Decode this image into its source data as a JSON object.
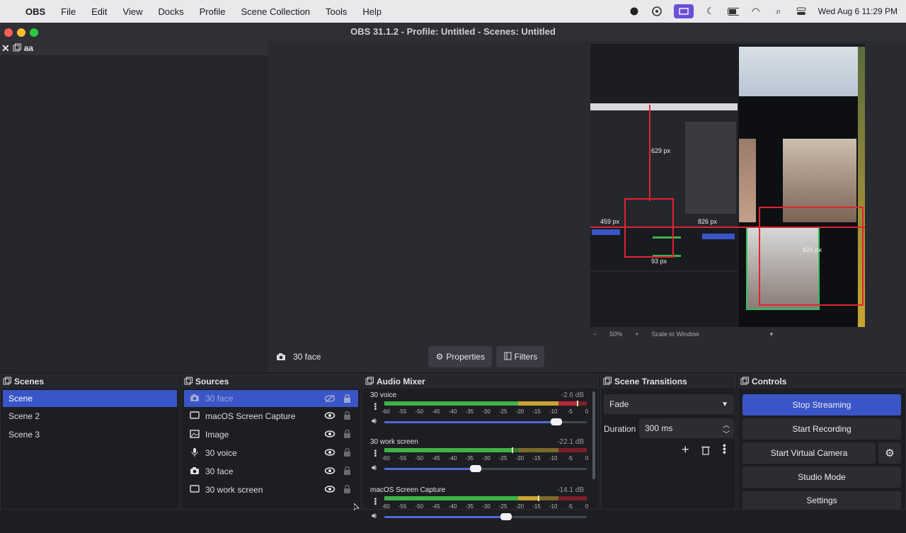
{
  "menubar": {
    "app": "OBS",
    "items": [
      "File",
      "Edit",
      "View",
      "Docks",
      "Profile",
      "Scene Collection",
      "Tools",
      "Help"
    ],
    "datetime": "Wed Aug 6  11:29 PM"
  },
  "window": {
    "title": "OBS 31.1.2 - Profile: Untitled - Scenes: Untitled"
  },
  "left_dock": {
    "title": "aa"
  },
  "preview": {
    "measure_labels": [
      "629 px",
      "459 px",
      "826 px",
      "826 px",
      "93 px"
    ],
    "zoom_minus": "−",
    "zoom_value": "50%",
    "zoom_plus": "+",
    "scale_mode": "Scale to Window"
  },
  "source_toolbar": {
    "current_source": "30 face",
    "properties_label": "Properties",
    "filters_label": "Filters"
  },
  "scenes": {
    "title": "Scenes",
    "items": [
      "Scene",
      "Scene 2",
      "Scene 3"
    ],
    "selected_index": 0
  },
  "sources": {
    "title": "Sources",
    "items": [
      {
        "name": "30 face",
        "icon": "camera-icon",
        "hidden": true
      },
      {
        "name": "macOS Screen Capture",
        "icon": "monitor-icon",
        "hidden": false
      },
      {
        "name": "Image",
        "icon": "image-icon",
        "hidden": false
      },
      {
        "name": "30 voice",
        "icon": "microphone-icon",
        "hidden": false
      },
      {
        "name": "30 face",
        "icon": "camera-icon",
        "hidden": false
      },
      {
        "name": "30 work screen",
        "icon": "monitor-icon",
        "hidden": false
      }
    ]
  },
  "mixer": {
    "title": "Audio Mixer",
    "tick_labels": [
      "-60",
      "-55",
      "-50",
      "-45",
      "-40",
      "-35",
      "-30",
      "-25",
      "-20",
      "-15",
      "-10",
      "-5",
      "0"
    ],
    "channels": [
      {
        "name": "30 voice",
        "db": "-2.6 dB",
        "level": 0.95,
        "volume": 0.85
      },
      {
        "name": "30 work screen",
        "db": "-22.1 dB",
        "level": 0.63,
        "volume": 0.45
      },
      {
        "name": "macOS Screen Capture",
        "db": "-14.1 dB",
        "level": 0.76,
        "volume": 0.6
      }
    ]
  },
  "transitions": {
    "title": "Scene Transitions",
    "type": "Fade",
    "duration_label": "Duration",
    "duration_value": "300 ms"
  },
  "controls": {
    "title": "Controls",
    "stop_streaming": "Stop Streaming",
    "start_recording": "Start Recording",
    "start_virtual_camera": "Start Virtual Camera",
    "studio_mode": "Studio Mode",
    "settings": "Settings"
  },
  "colors": {
    "accent": "#3a55c8",
    "meter_green": "#3fb24a",
    "meter_yellow": "#c9a531",
    "meter_red": "#c0283a",
    "measure_red": "#e0242f"
  }
}
